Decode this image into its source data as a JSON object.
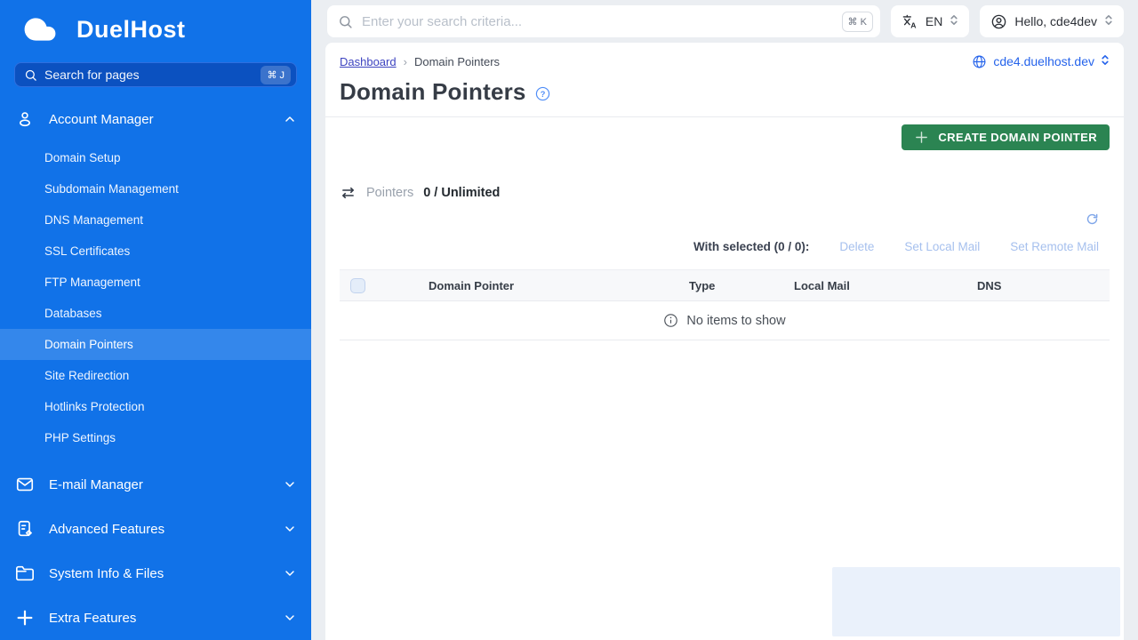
{
  "sidebar": {
    "logo_text": "DuelHost",
    "search": {
      "placeholder": "Search for pages",
      "shortcut": "⌘ J"
    },
    "sections": [
      {
        "label": "Account Manager",
        "icon": "user-icon",
        "expanded": true,
        "items": [
          "Domain Setup",
          "Subdomain Management",
          "DNS Management",
          "SSL Certificates",
          "FTP Management",
          "Databases",
          "Domain Pointers",
          "Site Redirection",
          "Hotlinks Protection",
          "PHP Settings"
        ],
        "active_item": "Domain Pointers"
      },
      {
        "label": "E-mail Manager",
        "icon": "mail-icon",
        "expanded": false
      },
      {
        "label": "Advanced Features",
        "icon": "document-gear-icon",
        "expanded": false
      },
      {
        "label": "System Info & Files",
        "icon": "folder-icon",
        "expanded": false
      },
      {
        "label": "Extra Features",
        "icon": "plus-icon",
        "expanded": false
      }
    ]
  },
  "topbar": {
    "search_placeholder": "Enter your search criteria...",
    "search_shortcut": "⌘ K",
    "language": "EN",
    "user_greeting": "Hello, cde4dev"
  },
  "breadcrumb": {
    "link": "Dashboard",
    "separator": "›",
    "current": "Domain Pointers"
  },
  "domain_selector": {
    "value": "cde4.duelhost.dev"
  },
  "page": {
    "title": "Domain Pointers",
    "create_button": "CREATE DOMAIN POINTER",
    "usage_label": "Pointers",
    "usage_value": "0 / Unlimited",
    "with_selected_label": "With selected (0 / 0):",
    "actions": [
      "Delete",
      "Set Local Mail",
      "Set Remote Mail"
    ],
    "table": {
      "headers": [
        "Domain Pointer",
        "Type",
        "Local Mail",
        "DNS"
      ],
      "empty_message": "No items to show"
    }
  },
  "colors": {
    "sidebar_blue": "#1172e8",
    "sidebar_search_bg": "#0b51c0",
    "active_item_bg": "rgba(255,255,255,0.15)",
    "topbar_gray": "#ebeef2",
    "create_button_green": "#2b8452",
    "breadcrumb_link": "#3d43c0",
    "domain_link_blue": "#2563eb",
    "disabled_action_blue": "#a6c0ee"
  }
}
